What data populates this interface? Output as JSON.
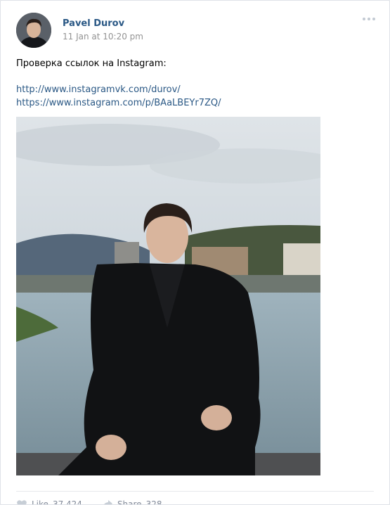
{
  "post": {
    "author": "Pavel Durov",
    "time": "11 Jan at 10:20 pm",
    "text": "Проверка ссылок на Instagram:",
    "links": [
      "http://www.instagramvk.com/durov/",
      "https://www.instagram.com/p/BAaLBEYr7ZQ/"
    ]
  },
  "actions": {
    "like_label": "Like",
    "like_count": "37 424",
    "share_label": "Share",
    "share_count": "328"
  },
  "colors": {
    "accent": "#2a5885",
    "muted": "#939393",
    "background": "#edeef0"
  }
}
